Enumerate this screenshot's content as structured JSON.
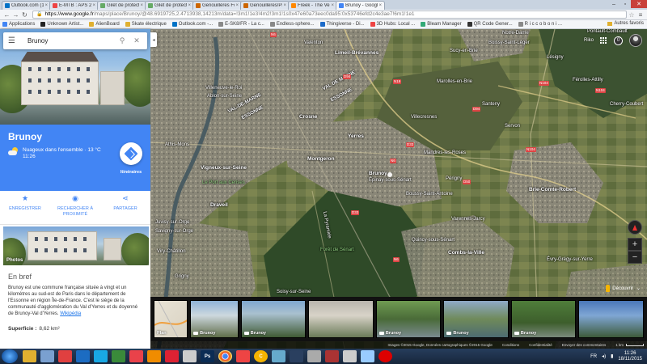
{
  "browser": {
    "tabs": [
      {
        "label": "Outlook.com (1) - f",
        "color": "#0072c6",
        "active": false
      },
      {
        "label": "E-MTB : APS 2WD",
        "color": "#e44",
        "active": false
      },
      {
        "label": "Gilet de protection",
        "color": "#6a6",
        "active": false
      },
      {
        "label": "Gilet de protection",
        "color": "#6a6",
        "active": false
      },
      {
        "label": "Genouillères Fox Ra",
        "color": "#c60",
        "active": false
      },
      {
        "label": "Genouillères/Protè",
        "color": "#c60",
        "active": false
      },
      {
        "label": "Freek - The Vendi",
        "color": "#f80",
        "active": false
      },
      {
        "label": "Brunoy - Google Ma",
        "color": "#4285f4",
        "active": true
      }
    ],
    "url_host": "https://www.google.fr",
    "url_path": "/maps/place/Brunoy/@48.6919725,2.4713938,14213m/data=!3m1!1e3!4m2!3m1!1s0x47e60a73eec0da95:0x53746efd2c4e3ae7!6m1!1e1",
    "bookmarks": [
      {
        "label": "Applications",
        "color": "#4285f4"
      },
      {
        "label": "Unknown Artist...",
        "color": "#222"
      },
      {
        "label": "AlienBoard",
        "color": "#e0b030"
      },
      {
        "label": "Skate électrique",
        "color": "#e0b030"
      },
      {
        "label": "Outlook.com -...",
        "color": "#0072c6"
      },
      {
        "label": "E-SK8/FR - La c...",
        "color": "#888"
      },
      {
        "label": "Endless-sphere...",
        "color": "#888"
      },
      {
        "label": "Thingiverse - Di...",
        "color": "#1b6ac9"
      },
      {
        "label": "3D Hubs: Local ...",
        "color": "#e44"
      },
      {
        "label": "Bleam Manager",
        "color": "#3a7"
      },
      {
        "label": "QR Code Gener...",
        "color": "#333"
      },
      {
        "label": "R i c c o b o n i ...",
        "color": "#888"
      }
    ],
    "other_bookmarks": "Autres favoris"
  },
  "panel": {
    "search_value": "Brunoy",
    "place_name": "Brunoy",
    "weather_text": "Nuageux dans l'ensemble · 13 °C",
    "weather_time": "11:26",
    "directions_label": "Itinéraires",
    "actions": [
      {
        "icon": "star-icon",
        "glyph": "★",
        "label": "ENREGISTRER"
      },
      {
        "icon": "pin-nearby-icon",
        "glyph": "◉",
        "label": "RECHERCHER À PROXIMITÉ"
      },
      {
        "icon": "share-icon",
        "glyph": "⋖",
        "label": "PARTAGER"
      }
    ],
    "photos_label": "Photos",
    "summary_title": "En bref",
    "summary_text": "Brunoy est une commune française située à vingt et un kilomètres au sud-est de Paris dans le département de l'Essonne en région Île-de-France. C'est le siège de la communauté d'agglomération du Val d'Yerres et du doyenné de Brunoy-Val d'Yerres.",
    "wiki_link": "Wikipédia",
    "area_label": "Superficie :",
    "area_value": "8,62 km²"
  },
  "map": {
    "user_label": "Riko",
    "notif_count": "0",
    "discover_label": "Découvrir",
    "labels": [
      {
        "text": "Valenton",
        "big": false
      },
      {
        "text": "Limeil-Brévannes",
        "big": true
      },
      {
        "text": "Sucy-en-Brie",
        "big": false
      },
      {
        "text": "Boissy-Saint-Léger",
        "big": false
      },
      {
        "text": "Lésigny",
        "big": false
      },
      {
        "text": "Férolles-Attilly",
        "big": false
      },
      {
        "text": "Cherry-Coubert",
        "big": false
      },
      {
        "text": "Villeneuve-le-Roi",
        "big": false
      },
      {
        "text": "Ablon-sur-Seine",
        "big": false
      },
      {
        "text": "Marolles-en-Brie",
        "big": false
      },
      {
        "text": "Santeny",
        "big": false
      },
      {
        "text": "Servon",
        "big": false
      },
      {
        "text": "Crosne",
        "big": true
      },
      {
        "text": "Yerres",
        "big": true
      },
      {
        "text": "Villecresnes",
        "big": false
      },
      {
        "text": "Athis-Mons",
        "big": false
      },
      {
        "text": "Montgeron",
        "big": true
      },
      {
        "text": "Mandres-les-Roses",
        "big": false
      },
      {
        "text": "Vigneux-sur-Seine",
        "big": true
      },
      {
        "text": "Brunoy",
        "big": true
      },
      {
        "text": "Épinay-sous-Sénart",
        "big": false
      },
      {
        "text": "Périgny",
        "big": false
      },
      {
        "text": "Brie-Comte-Robert",
        "big": true
      },
      {
        "text": "Draveil",
        "big": true
      },
      {
        "text": "Boussy-Saint-Antoine",
        "big": false
      },
      {
        "text": "Varennes-Jarcy",
        "big": false
      },
      {
        "text": "Quincy-sous-Sénart",
        "big": false
      },
      {
        "text": "Combs-la-Ville",
        "big": true
      },
      {
        "text": "Juvisy-sur-Orge",
        "big": false
      },
      {
        "text": "Savigny-sur-Orge",
        "big": false
      },
      {
        "text": "Viry-Châtillon",
        "big": false
      },
      {
        "text": "Grigny",
        "big": false
      },
      {
        "text": "Soisy-sur-Seine",
        "big": false
      },
      {
        "text": "Évry-Grégy-sur-Yerre",
        "big": false
      },
      {
        "text": "Pontault-Combault",
        "big": false
      },
      {
        "text": "Notre-Dame",
        "big": false
      },
      {
        "text": "Le Port aux Cerises",
        "big": false
      },
      {
        "text": "Forêt de Sénart",
        "big": false
      },
      {
        "text": "La Pyramide",
        "big": false
      }
    ],
    "region_labels": [
      "VAL-DE-MARNE",
      "ESSONNE",
      "VAL DE MARNE",
      "ESSONNE"
    ],
    "road_numbers": [
      "N6",
      "D94",
      "N19",
      "N104",
      "D94",
      "N104",
      "D33",
      "N6",
      "D50",
      "N104",
      "D33",
      "N6"
    ],
    "carousel": [
      {
        "caption": "Plan",
        "kind": "map"
      },
      {
        "caption": "Brunoy",
        "kind": "photo"
      },
      {
        "caption": "Brunoy",
        "kind": "photo"
      },
      {
        "caption": "",
        "kind": "photo"
      },
      {
        "caption": "Brunoy",
        "kind": "photo"
      },
      {
        "caption": "Brunoy",
        "kind": "photo"
      },
      {
        "caption": "Brunoy",
        "kind": "photo"
      },
      {
        "caption": "",
        "kind": "photo"
      }
    ],
    "footer": {
      "imagery": "Images ©2015 Google, Données cartographiques ©2015 Google",
      "terms": "Conditions",
      "privacy": "Confidentialité",
      "feedback": "Envoyer des commentaires",
      "scale": "1 km"
    }
  },
  "taskbar": {
    "apps": [
      {
        "name": "explorer-app",
        "color": "#e0b030",
        "label": ""
      },
      {
        "name": "libraries-app",
        "color": "#7aa0d0",
        "label": ""
      },
      {
        "name": "media-app",
        "color": "#e04040",
        "label": ""
      },
      {
        "name": "teamviewer-app",
        "color": "#1c6cc2",
        "label": ""
      },
      {
        "name": "skype-app",
        "color": "#19a8e4",
        "label": ""
      },
      {
        "name": "folder-app",
        "color": "#3a8a3a",
        "label": ""
      },
      {
        "name": "pocket-app",
        "color": "#e9424a",
        "label": ""
      },
      {
        "name": "vlc-app",
        "color": "#f08c00",
        "label": ""
      },
      {
        "name": "unity-app",
        "color": "#d23",
        "label": ""
      },
      {
        "name": "3d-app",
        "color": "#ccc",
        "label": ""
      },
      {
        "name": "photoshop-app",
        "color": "#0b2c54",
        "label": "Ps"
      },
      {
        "name": "chrome-app",
        "color": "#4285f4",
        "label": ""
      },
      {
        "name": "gmail-app",
        "color": "#e44",
        "label": ""
      },
      {
        "name": "c-app",
        "color": "#f5b400",
        "label": "C"
      },
      {
        "name": "tool-app",
        "color": "#6ac",
        "label": ""
      },
      {
        "name": "steam-app",
        "color": "#2a3f5f",
        "label": ""
      },
      {
        "name": "sketch-app",
        "color": "#aaa",
        "label": ""
      },
      {
        "name": "game-app",
        "color": "#a33",
        "label": ""
      },
      {
        "name": "itunes-app",
        "color": "#ccc",
        "label": ""
      },
      {
        "name": "im-app",
        "color": "#9cf",
        "label": ""
      },
      {
        "name": "opera-app",
        "color": "#d00",
        "label": ""
      }
    ],
    "language": "FR",
    "time": "11:26",
    "date": "18/11/2015"
  }
}
